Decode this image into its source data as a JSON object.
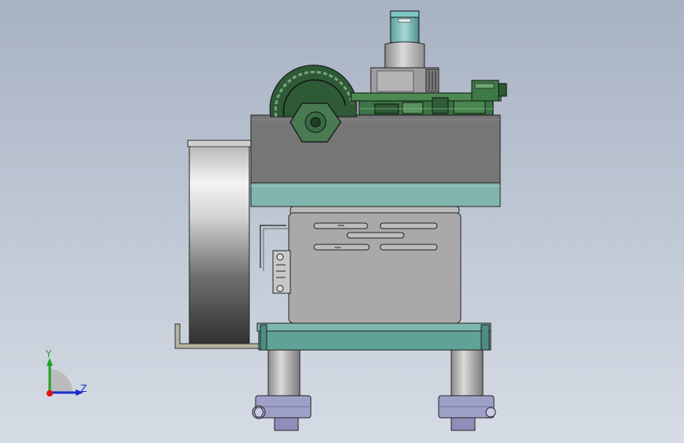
{
  "viewport": {
    "background_top": "#a7b2c2",
    "background_bottom": "#d6dce5"
  },
  "colors": {
    "teal_plate": "#5fa396",
    "gray_housing": "#767676",
    "pcb_green": "#3d7d48",
    "steel": "#a9a9a9",
    "bearing_blue": "#9ea0c8"
  },
  "triad": {
    "y_label": "Y",
    "z_label": "Z",
    "y_color": "#1fa023",
    "z_color": "#1a2fd0",
    "x_color": "#e11010"
  }
}
